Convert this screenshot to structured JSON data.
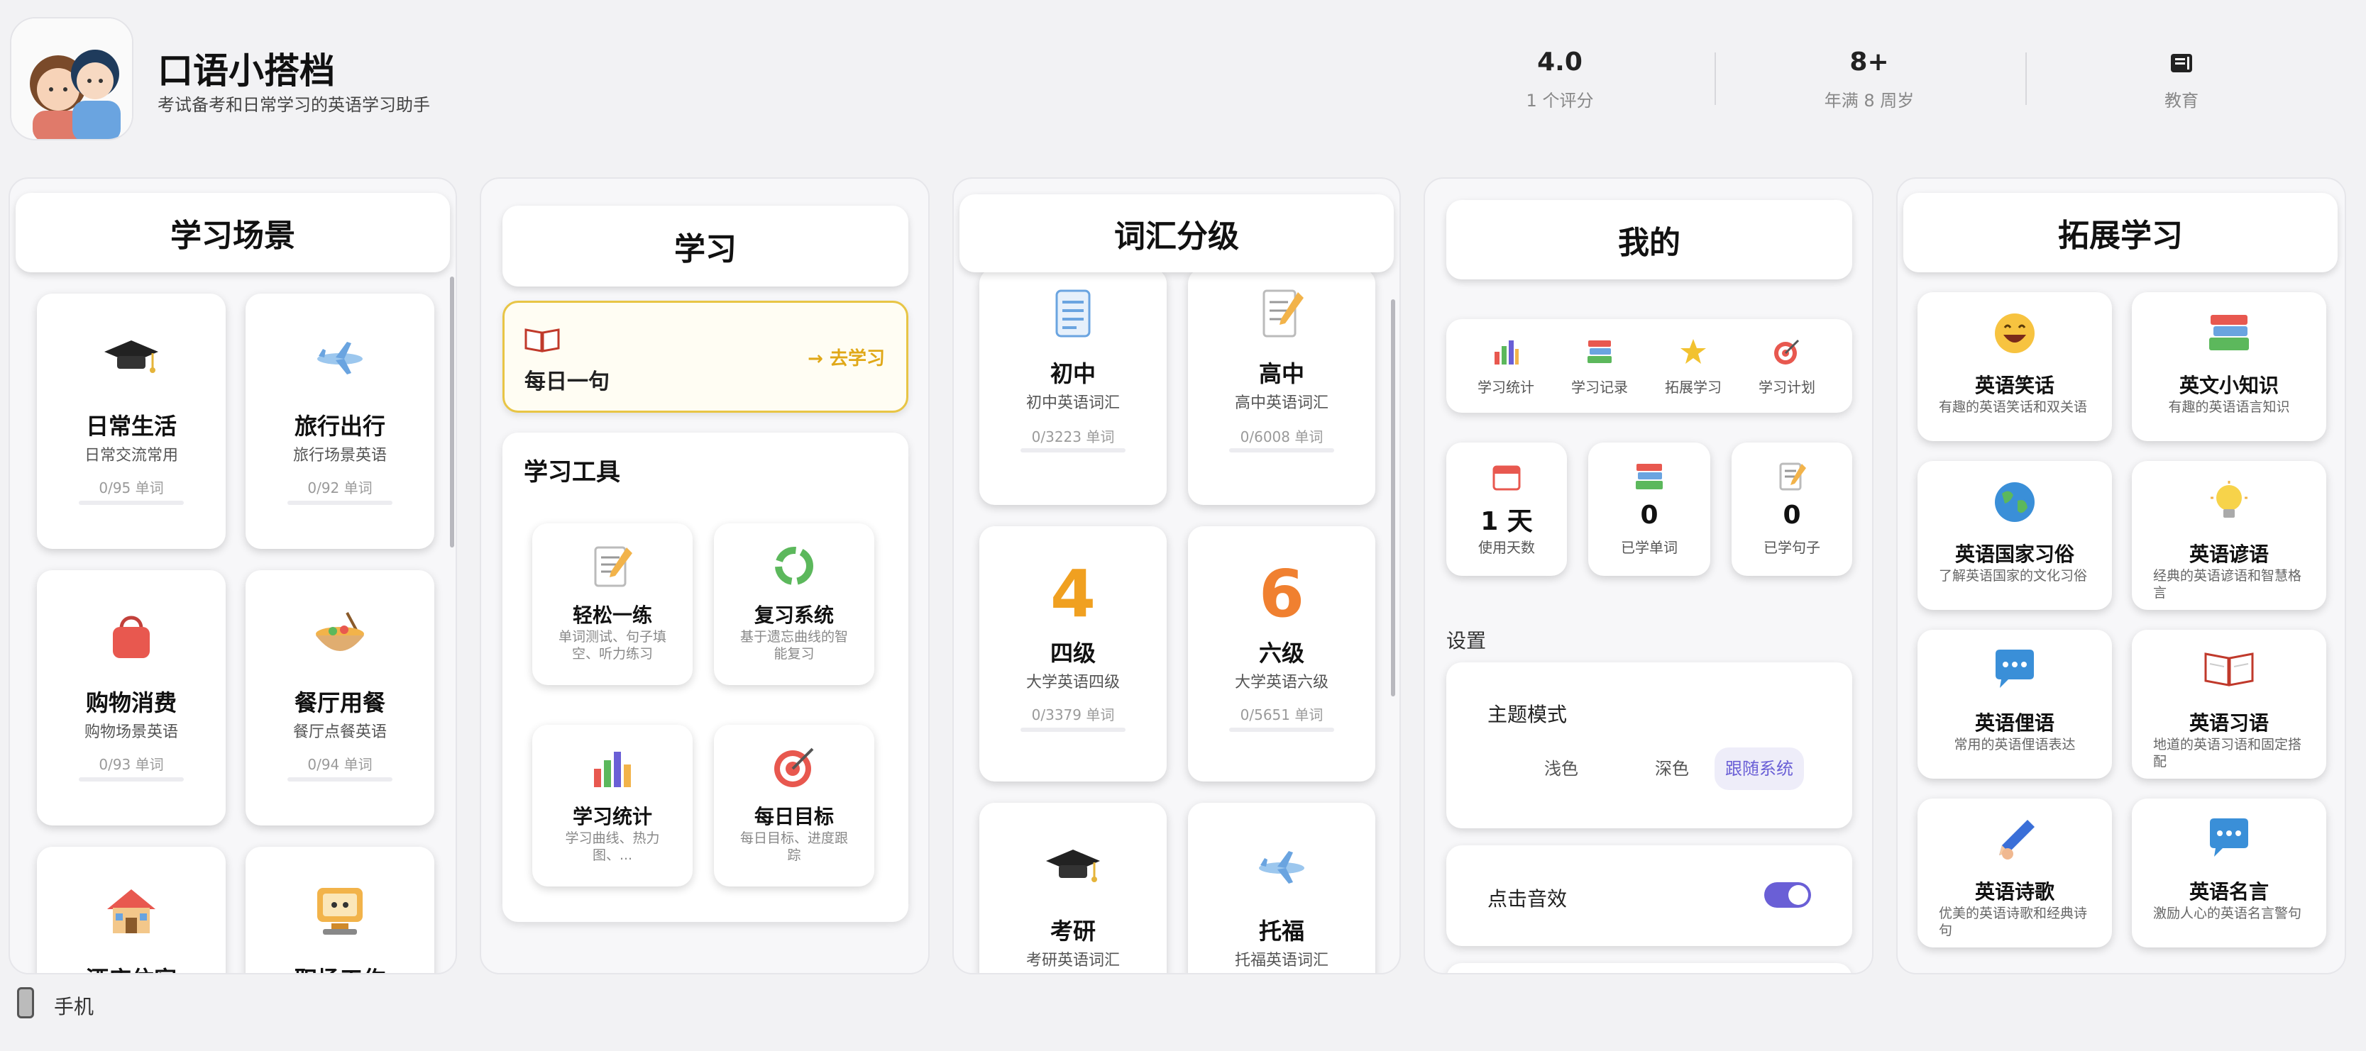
{
  "app": {
    "name": "口语小搭档",
    "subtitle": "考试备考和日常学习的英语学习助手"
  },
  "stats": [
    {
      "value": "4.0",
      "label": "1 个评分"
    },
    {
      "value": "8+",
      "label": "年满 8 周岁"
    },
    {
      "value": "",
      "label": "教育",
      "icon": "book-icon"
    }
  ],
  "scenes": {
    "title": "学习场景",
    "items": [
      {
        "name": "日常生活",
        "desc": "日常交流常用",
        "count": "0/95 单词",
        "icon": "graduation-cap-icon"
      },
      {
        "name": "旅行出行",
        "desc": "旅行场景英语",
        "count": "0/92 单词",
        "icon": "airplane-icon"
      },
      {
        "name": "购物消费",
        "desc": "购物场景英语",
        "count": "0/93 单词",
        "icon": "shopping-bag-icon"
      },
      {
        "name": "餐厅用餐",
        "desc": "餐厅点餐英语",
        "count": "0/94 单词",
        "icon": "food-bowl-icon"
      },
      {
        "name": "酒店住宿",
        "icon": "house-icon"
      },
      {
        "name": "职场工作",
        "icon": "computer-icon"
      }
    ]
  },
  "study": {
    "title": "学习",
    "daily_sentence": "每日一句",
    "go_study": "去学习",
    "tools_title": "学习工具",
    "tools": [
      {
        "name": "轻松一练",
        "desc": "单词测试、句子填空、听力练习",
        "icon": "memo-icon"
      },
      {
        "name": "复习系统",
        "desc": "基于遗忘曲线的智能复习",
        "icon": "cycle-icon"
      },
      {
        "name": "学习统计",
        "desc": "学习曲线、热力图、...",
        "icon": "bar-chart-icon"
      },
      {
        "name": "每日目标",
        "desc": "每日目标、进度跟踪",
        "icon": "target-icon"
      }
    ]
  },
  "vocab": {
    "title": "词汇分级",
    "items": [
      {
        "name": "初中",
        "desc": "初中英语词汇",
        "count": "0/3223 单词",
        "icon": "document-icon"
      },
      {
        "name": "高中",
        "desc": "高中英语词汇",
        "count": "0/6008 单词",
        "icon": "memo-icon"
      },
      {
        "name": "四级",
        "desc": "大学英语四级",
        "count": "0/3379 单词",
        "icon": "number-4-icon",
        "glyph": "4"
      },
      {
        "name": "六级",
        "desc": "大学英语六级",
        "count": "0/5651 单词",
        "icon": "number-6-icon",
        "glyph": "6"
      },
      {
        "name": "考研",
        "desc": "考研英语词汇",
        "icon": "graduation-cap-icon"
      },
      {
        "name": "托福",
        "desc": "托福英语词汇",
        "icon": "airplane-icon"
      }
    ]
  },
  "me": {
    "title": "我的",
    "entries": [
      {
        "label": "学习统计",
        "icon": "bar-chart-icon"
      },
      {
        "label": "学习记录",
        "icon": "books-icon"
      },
      {
        "label": "拓展学习",
        "icon": "star-icon"
      },
      {
        "label": "学习计划",
        "icon": "target-icon"
      }
    ],
    "stats": [
      {
        "value": "1 天",
        "label": "使用天数",
        "icon": "calendar-icon"
      },
      {
        "value": "0",
        "label": "已学单词",
        "icon": "books-icon"
      },
      {
        "value": "0",
        "label": "已学句子",
        "icon": "memo-icon"
      }
    ],
    "settings_title": "设置",
    "theme_title": "主题模式",
    "theme_options": [
      "浅色",
      "深色",
      "跟随系统"
    ],
    "sound_label": "点击音效",
    "sound_on": true
  },
  "ext": {
    "title": "拓展学习",
    "items": [
      {
        "name": "英语笑话",
        "desc": "有趣的英语笑话和双关语",
        "icon": "smile-icon"
      },
      {
        "name": "英文小知识",
        "desc": "有趣的英语语言知识",
        "icon": "books-icon"
      },
      {
        "name": "英语国家习俗",
        "desc": "了解英语国家的文化习俗",
        "icon": "globe-icon"
      },
      {
        "name": "英语谚语",
        "desc": "经典的英语谚语和智慧格言",
        "icon": "lightbulb-icon"
      },
      {
        "name": "英语俚语",
        "desc": "常用的英语俚语表达",
        "icon": "speech-bubble-icon"
      },
      {
        "name": "英语习语",
        "desc": "地道的英语习语和固定搭配",
        "icon": "open-book-icon"
      },
      {
        "name": "英语诗歌",
        "desc": "优美的英语诗歌和经典诗句",
        "icon": "pen-icon"
      },
      {
        "name": "英语名言",
        "desc": "激励人心的英语名言警句",
        "icon": "speech-bubble-icon"
      }
    ]
  },
  "footer": {
    "device_label": "手机",
    "icon": "phone-icon"
  },
  "colors": {
    "accent": "#6a5fd6",
    "highlight": "#e8c545",
    "highlight_bg": "#fffdf3"
  }
}
